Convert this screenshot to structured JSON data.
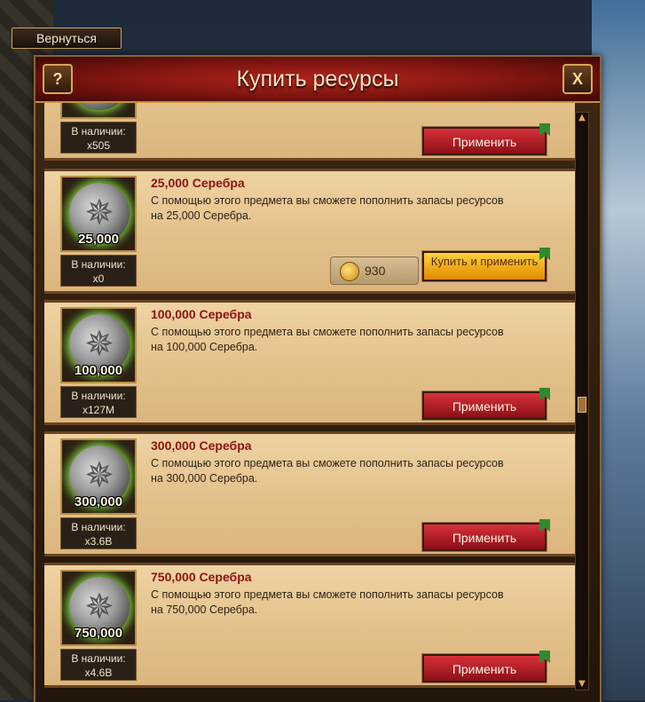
{
  "back_button": {
    "label": "Вернуться"
  },
  "dialog": {
    "title": "Купить ресурсы",
    "help_label": "?",
    "close_label": "X"
  },
  "items": [
    {
      "stock_label": "В наличии:",
      "stock": "x505",
      "apply_label": "Применить"
    },
    {
      "name": "25,000 Серебра",
      "description": "С помощью этого предмета вы сможете пополнить запасы ресурсов на 25,000 Серебра.",
      "amount": "25,000",
      "stock_label": "В наличии:",
      "stock": "x0",
      "price": "930",
      "buy_label": "Купить и применить"
    },
    {
      "name": "100,000 Серебра",
      "description": "С помощью этого предмета вы сможете пополнить запасы ресурсов на 100,000 Серебра.",
      "amount": "100,000",
      "stock_label": "В наличии:",
      "stock": "x127M",
      "apply_label": "Применить"
    },
    {
      "name": "300,000 Серебра",
      "description": "С помощью этого предмета вы сможете пополнить запасы ресурсов на 300,000 Серебра.",
      "amount": "300,000",
      "stock_label": "В наличии:",
      "stock": "x3.6B",
      "apply_label": "Применить"
    },
    {
      "name": "750,000 Серебра",
      "description": "С помощью этого предмета вы сможете пополнить запасы ресурсов на 750,000 Серебра.",
      "amount": "750,000",
      "stock_label": "В наличии:",
      "stock": "x4.6B",
      "apply_label": "Применить"
    }
  ],
  "icons": {
    "coin": "silver-coin-icon",
    "gold": "gold-coin-icon"
  },
  "colors": {
    "title_red": "#8d1412",
    "apply_red": "#c21f2a",
    "buy_gold": "#f3b21a",
    "parchment": "#e4c28d"
  }
}
